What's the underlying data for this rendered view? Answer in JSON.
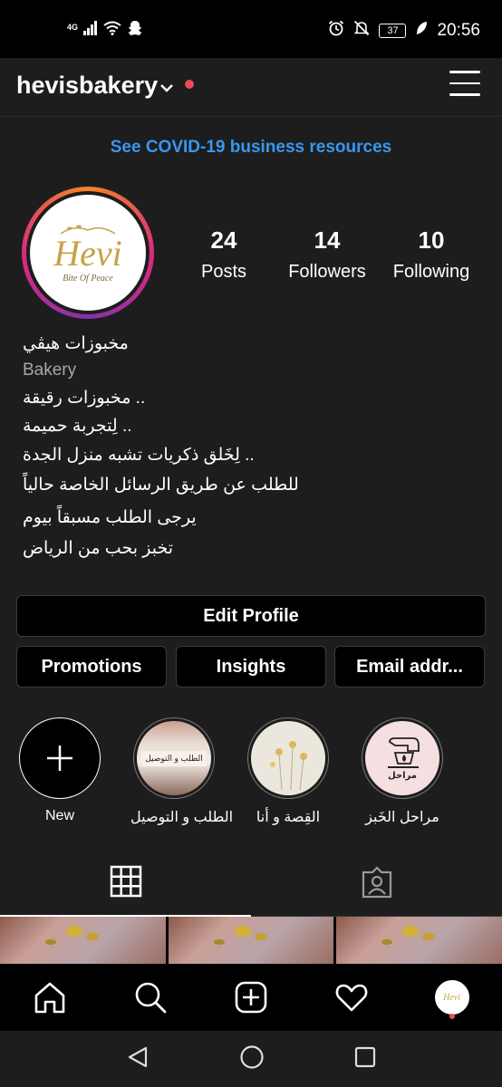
{
  "status_bar": {
    "network": "4G",
    "battery": "37",
    "time": "20:56"
  },
  "header": {
    "username": "hevisbakery"
  },
  "banner": {
    "text": "See COVID-19 business resources"
  },
  "profile": {
    "stats": [
      {
        "value": "24",
        "label": "Posts"
      },
      {
        "value": "14",
        "label": "Followers"
      },
      {
        "value": "10",
        "label": "Following"
      }
    ],
    "avatar_logo": "Hevi",
    "avatar_tagline": "Bite Of Peace",
    "name": "مخبوزات هيڤي",
    "category": "Bakery",
    "bio_lines": [
      "مخبوزات رقيقة ..",
      "لِتجربة حميمة ..",
      "لِخَلق ذكريات تشبه منزل الجدة ..",
      "للطلب عن طريق الرسائل الخاصة حالياً",
      "يرجى الطلب مسبقاً بيوم",
      "تخبز بحب من الرياض"
    ]
  },
  "buttons": {
    "edit_profile": "Edit Profile",
    "promotions": "Promotions",
    "insights": "Insights",
    "email": "Email addr..."
  },
  "highlights": [
    {
      "label": "New"
    },
    {
      "label": "الطلب و التوصيل",
      "cover_text": "الطلب و التوصيل"
    },
    {
      "label": "القِصة و أنا"
    },
    {
      "label": "مراحل الخَبز",
      "cover_text": "مراحل"
    }
  ],
  "colors": {
    "accent_link": "#3897f0",
    "notification_dot": "#ed4956",
    "surface": "#1d1d1d"
  }
}
